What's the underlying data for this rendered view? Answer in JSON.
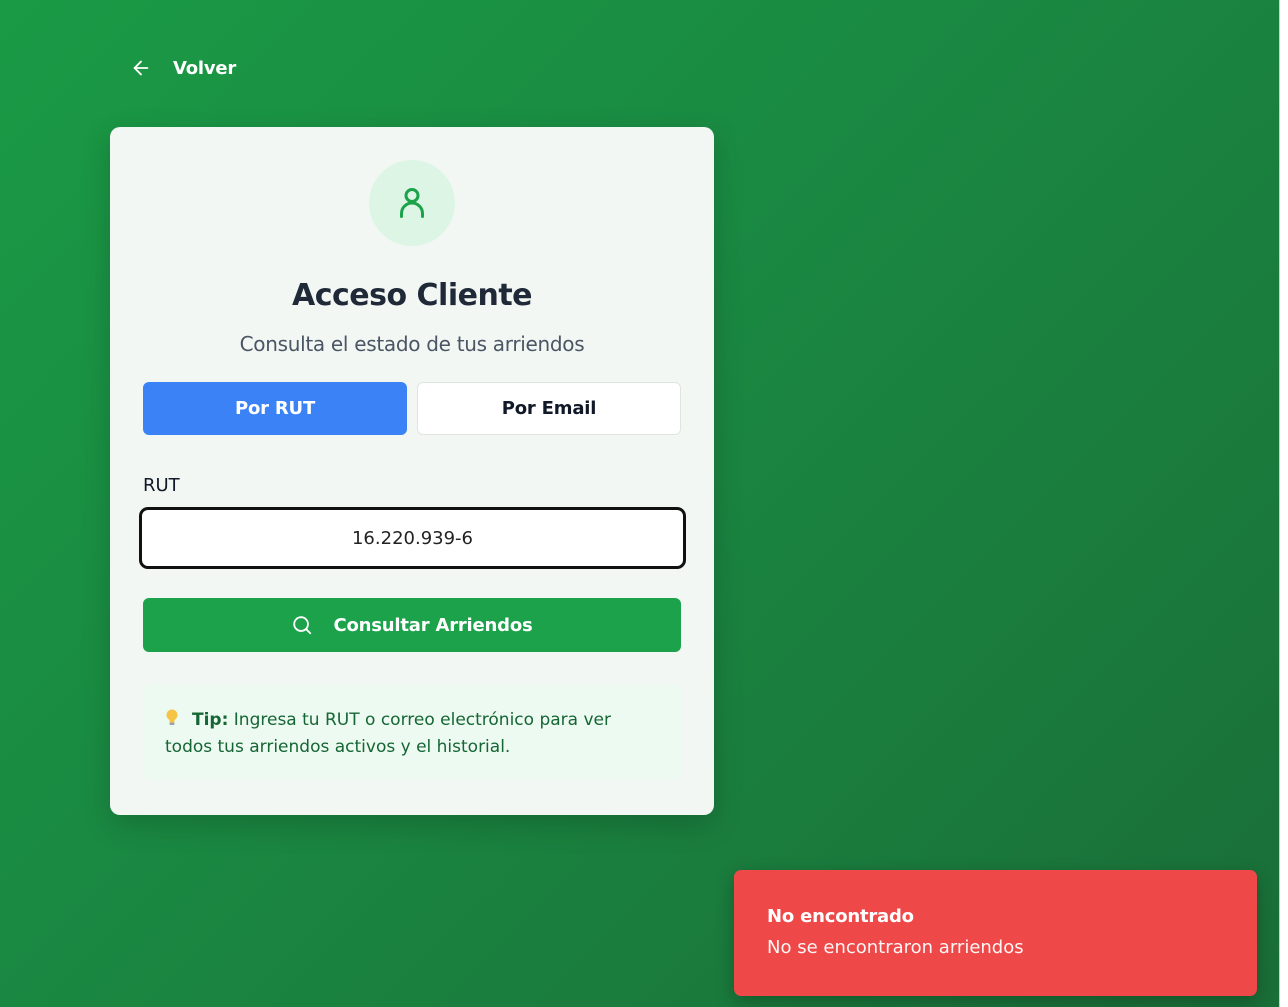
{
  "nav": {
    "back_label": "Volver"
  },
  "card": {
    "title": "Acceso Cliente",
    "subtitle": "Consulta el estado de tus arriendos",
    "tabs": [
      {
        "label": "Por RUT",
        "active": true
      },
      {
        "label": "Por Email",
        "active": false
      }
    ],
    "field_label": "RUT",
    "rut_value": "16.220.939-6",
    "submit_label": "Consultar Arriendos",
    "tip": {
      "label": "Tip:",
      "text": "Ingresa tu RUT o correo electrónico para ver todos tus arriendos activos y el historial."
    }
  },
  "toast": {
    "title": "No encontrado",
    "message": "No se encontraron arriendos"
  },
  "icons": {
    "back": "arrow-left-icon",
    "avatar": "user-icon",
    "search": "search-icon",
    "tip": "lightbulb-icon"
  },
  "colors": {
    "background": "#1a8a42",
    "card": "#f2f7f4",
    "active_tab": "#3b82f6",
    "submit": "#1ca24a",
    "tip_background": "#ecfaf1",
    "tip_text": "#166534",
    "toast": "#ef4848"
  }
}
